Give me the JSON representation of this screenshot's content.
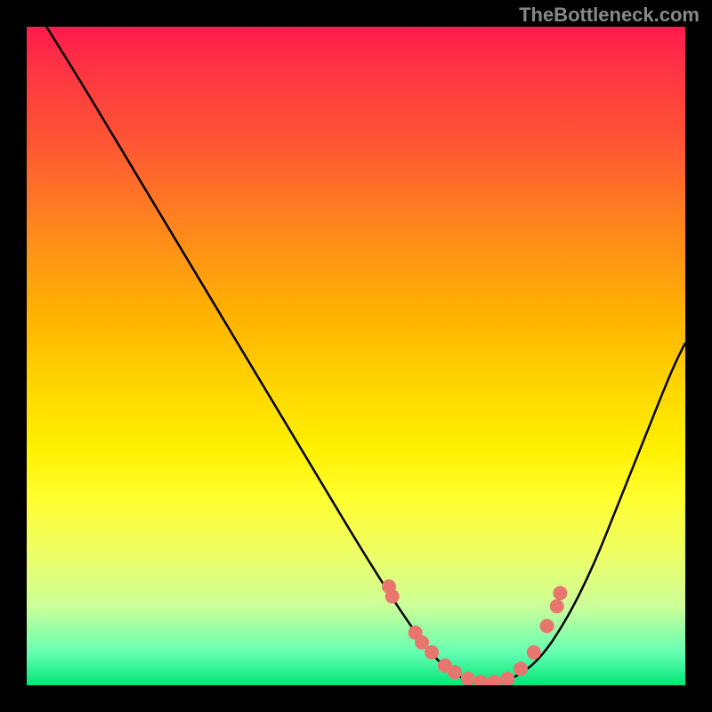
{
  "watermark": "TheBottleneck.com",
  "chart_data": {
    "type": "line",
    "title": "",
    "xlabel": "",
    "ylabel": "",
    "xlim": [
      0,
      100
    ],
    "ylim": [
      0,
      100
    ],
    "curve": {
      "x": [
        3,
        8,
        14,
        20,
        26,
        32,
        38,
        44,
        50,
        55,
        59,
        63,
        66,
        70,
        74,
        78,
        82,
        86,
        90,
        94,
        98,
        100
      ],
      "y": [
        100,
        92,
        82,
        72,
        62,
        52,
        42,
        32,
        22,
        14,
        8,
        3,
        1,
        0,
        1,
        4,
        10,
        18,
        28,
        38,
        48,
        52
      ]
    },
    "scatter_points": {
      "x": [
        55,
        55.5,
        59,
        60,
        61.5,
        63.5,
        65,
        67,
        69,
        71,
        73,
        75,
        77,
        79,
        80.5,
        81
      ],
      "y": [
        15,
        13.5,
        8,
        6.5,
        5,
        3,
        2,
        1,
        0.5,
        0.5,
        1,
        2.5,
        5,
        9,
        12,
        14
      ]
    }
  }
}
